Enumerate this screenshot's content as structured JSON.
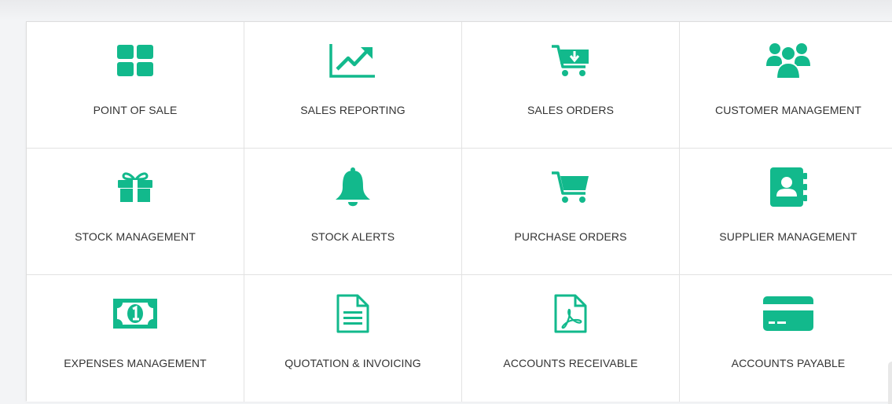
{
  "theme": {
    "accent": "#12b98c",
    "tile_background": "#ffffff",
    "page_background": "#f3f4f6",
    "text_color": "#333333"
  },
  "modules": [
    {
      "id": "point-of-sale",
      "label": "POINT OF SALE",
      "icon": "grid-icon"
    },
    {
      "id": "sales-reporting",
      "label": "SALES REPORTING",
      "icon": "line-chart-icon"
    },
    {
      "id": "sales-orders",
      "label": "SALES ORDERS",
      "icon": "cart-download-icon"
    },
    {
      "id": "customer-management",
      "label": "CUSTOMER MANAGEMENT",
      "icon": "users-icon"
    },
    {
      "id": "stock-management",
      "label": "STOCK MANAGEMENT",
      "icon": "gift-icon"
    },
    {
      "id": "stock-alerts",
      "label": "STOCK ALERTS",
      "icon": "bell-icon"
    },
    {
      "id": "purchase-orders",
      "label": "PURCHASE ORDERS",
      "icon": "shopping-cart-icon"
    },
    {
      "id": "supplier-management",
      "label": "SUPPLIER MANAGEMENT",
      "icon": "address-book-icon"
    },
    {
      "id": "expenses-management",
      "label": "EXPENSES MANAGEMENT",
      "icon": "money-bill-icon"
    },
    {
      "id": "quotation-invoicing",
      "label": "QUOTATION & INVOICING",
      "icon": "file-text-icon"
    },
    {
      "id": "accounts-receivable",
      "label": "ACCOUNTS RECEIVABLE",
      "icon": "file-pdf-icon"
    },
    {
      "id": "accounts-payable",
      "label": "ACCOUNTS PAYABLE",
      "icon": "credit-card-icon"
    }
  ]
}
